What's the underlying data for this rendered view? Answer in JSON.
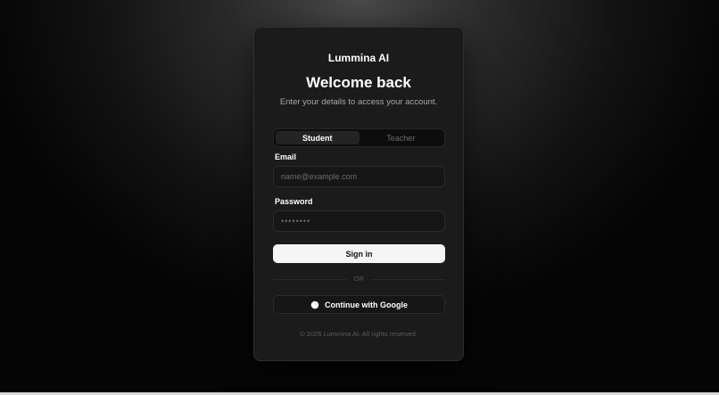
{
  "brand": {
    "name": "Lummina AI"
  },
  "header": {
    "title": "Welcome back",
    "subtitle": "Enter your details to access your account."
  },
  "role_toggle": {
    "options": [
      {
        "label": "Student",
        "selected": true
      },
      {
        "label": "Teacher",
        "selected": false
      }
    ]
  },
  "form": {
    "email": {
      "label": "Email",
      "value": "",
      "placeholder": "name@example.com"
    },
    "password": {
      "label": "Password",
      "value": "",
      "placeholder": "••••••••"
    },
    "signin_label": "Sign in",
    "divider_text": "OR",
    "google_label": "Continue with Google",
    "google_icon": "google-icon"
  },
  "footer": {
    "copyright": "© 2026 Lummina AI. All rights reserved."
  },
  "colors": {
    "card_bg": "#1b1b1b",
    "primary_button_bg": "#f5f5f5",
    "muted_text": "#a8a8a8"
  }
}
